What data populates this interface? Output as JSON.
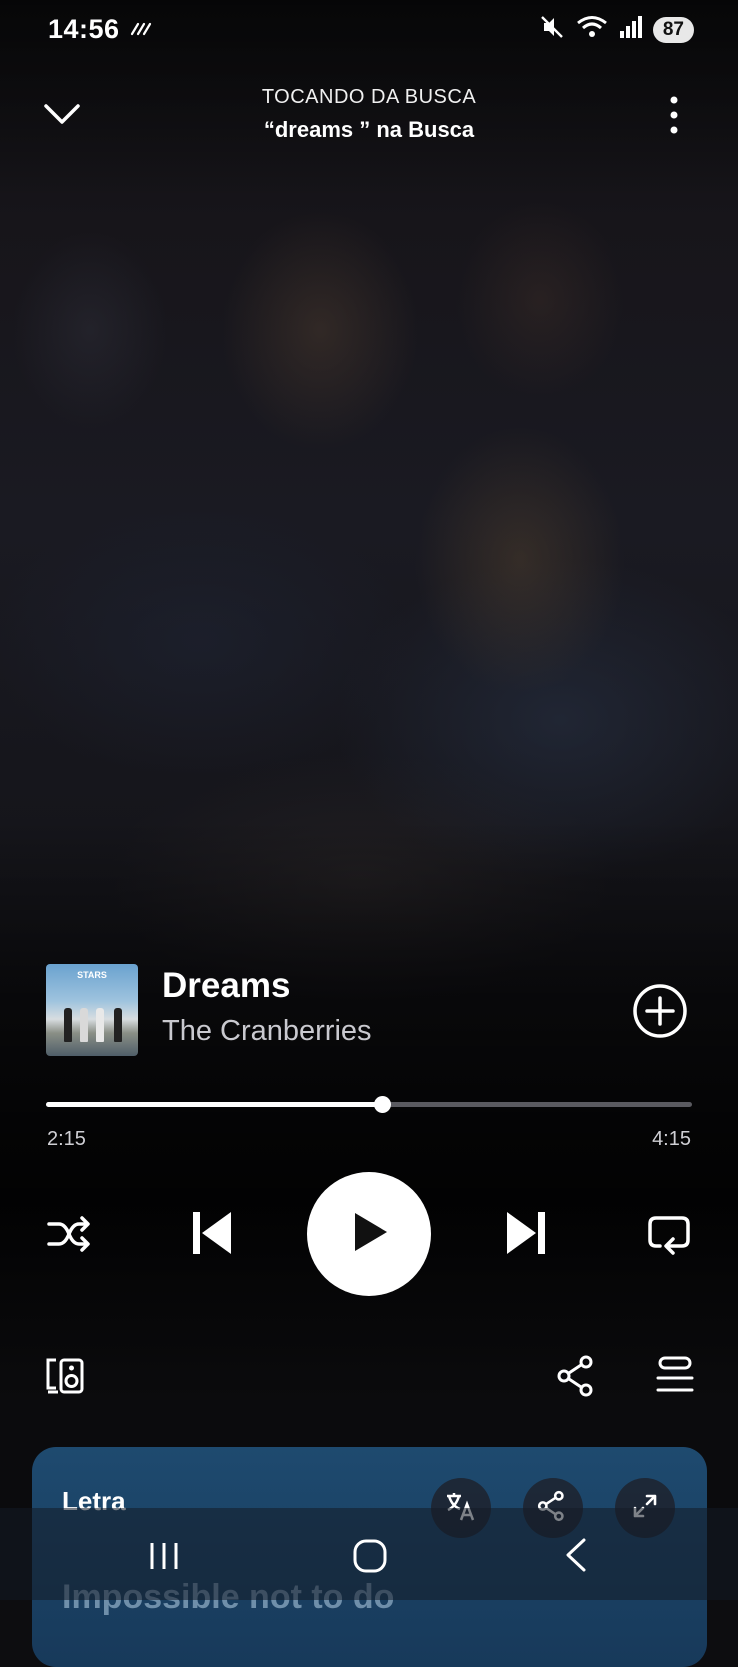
{
  "status_bar": {
    "time": "14:56",
    "battery": "87",
    "icons": [
      "nfc-icon",
      "mute-icon",
      "wifi-icon",
      "signal-icon"
    ]
  },
  "header": {
    "context_label": "TOCANDO DA BUSCA",
    "context_title": "“dreams ” na Busca",
    "collapse_icon": "chevron-down-icon",
    "menu_icon": "more-vertical-icon"
  },
  "track": {
    "title": "Dreams",
    "artist": "The Cranberries",
    "cover_text": "STARS",
    "add_icon": "add-circle-icon"
  },
  "progress": {
    "current": "2:15",
    "total": "4:15",
    "fraction": 0.52
  },
  "controls": [
    "shuffle-icon",
    "previous-icon",
    "play-icon",
    "next-icon",
    "repeat-icon"
  ],
  "bottom_actions": [
    "connect-device-icon",
    "share-icon",
    "queue-icon"
  ],
  "lyrics": {
    "title": "Letra",
    "preview_line": "Impossible not to do",
    "accent": "#1e4a6f"
  },
  "nav": [
    "recent-apps-icon",
    "home-icon",
    "back-icon"
  ],
  "colors": {
    "background": "#0d0d10",
    "text_primary": "#ffffff",
    "text_secondary": "#c9c9cf",
    "progress_track": "#5a5a60"
  }
}
